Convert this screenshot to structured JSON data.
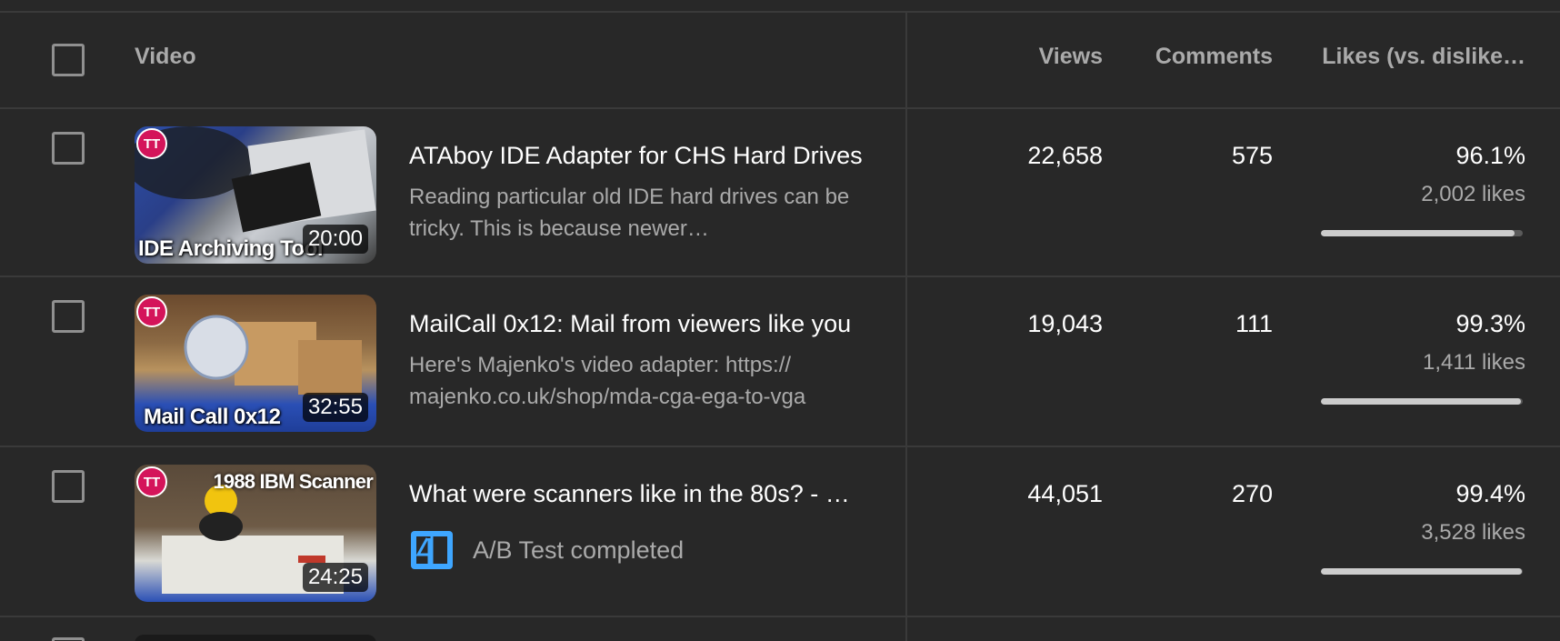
{
  "header": {
    "video": "Video",
    "views": "Views",
    "comments": "Comments",
    "likes": "Likes (vs. dislike…"
  },
  "rows": [
    {
      "title": "ATAboy IDE Adapter for CHS Hard Drives",
      "description": "Reading particular old IDE hard drives can be tricky. This is because newer…",
      "thumb_caption": "IDE Archiving Tool",
      "thumb_caption_top": "",
      "duration": "20:00",
      "views": "22,658",
      "comments": "575",
      "likes_pct": "96.1%",
      "likes_count": "2,002 likes",
      "likes_fraction": 0.961,
      "ab_test": ""
    },
    {
      "title": "MailCall 0x12: Mail from viewers like you",
      "description": "Here's Majenko's video adapter: https:// majenko.co.uk/shop/mda-cga-ega-to-vga",
      "thumb_caption": "Mail Call 0x12",
      "thumb_caption_top": "",
      "duration": "32:55",
      "views": "19,043",
      "comments": "111",
      "likes_pct": "99.3%",
      "likes_count": "1,411 likes",
      "likes_fraction": 0.993,
      "ab_test": ""
    },
    {
      "title": "What were scanners like in the 80s? - …",
      "description": "",
      "thumb_caption": "",
      "thumb_caption_top": "1988 IBM Scanner",
      "duration": "24:25",
      "views": "44,051",
      "comments": "270",
      "likes_pct": "99.4%",
      "likes_count": "3,528 likes",
      "likes_fraction": 0.994,
      "ab_test": "A/B Test completed"
    }
  ],
  "channel_badge": "TT",
  "colors": {
    "background": "#282828",
    "accent_ab": "#3ea6ff",
    "bar_fill": "#cccccc",
    "bar_track": "#5a5a5a"
  }
}
